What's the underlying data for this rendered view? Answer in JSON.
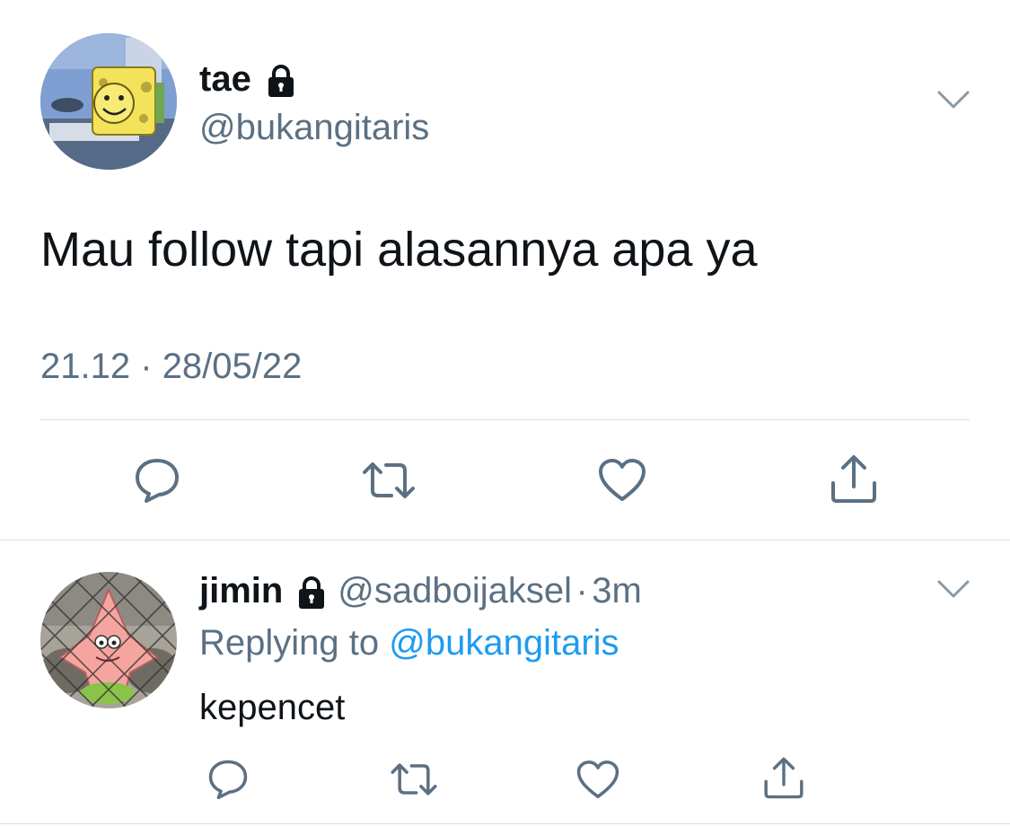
{
  "main_tweet": {
    "display_name": "tae",
    "handle": "@bukangitaris",
    "text": "Mau follow tapi alasannya apa ya",
    "time": "21.12",
    "separator": "·",
    "date": "28/05/22",
    "avatar_icon": "spongebob-avatar",
    "locked_icon": "lock-icon"
  },
  "reply": {
    "display_name": "jimin",
    "handle": "@sadboijaksel",
    "separator": "·",
    "age": "3m",
    "replying_prefix": "Replying to",
    "replying_to": "@bukangitaris",
    "text": "kepencet",
    "avatar_icon": "patrick-avatar",
    "locked_icon": "lock-icon"
  },
  "actions": [
    "reply-icon",
    "retweet-icon",
    "like-icon",
    "share-icon"
  ],
  "colors": {
    "text": "#0f1419",
    "secondary": "#5b7083",
    "link": "#1d9bf0",
    "divider": "#d9dde1",
    "icon": "#5b7083"
  }
}
